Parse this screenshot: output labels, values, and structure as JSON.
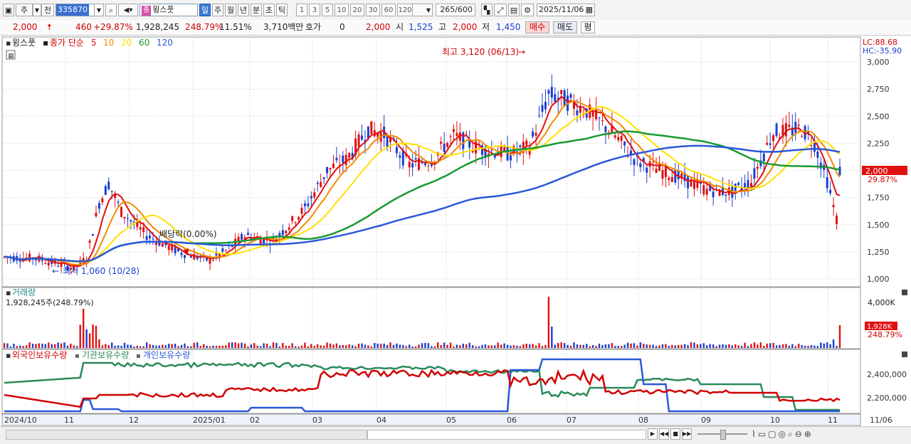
{
  "toolbar": {
    "market_label": "주",
    "prev_label": "전",
    "code": "335870",
    "name_tag": "종",
    "name": "윙스풋",
    "periods": [
      "일",
      "주",
      "월",
      "년",
      "분",
      "초",
      "틱"
    ],
    "selected_period": "일",
    "intervals": [
      "1",
      "3",
      "5",
      "10",
      "20",
      "30",
      "60",
      "120"
    ],
    "count": "265",
    "count_total": "/600",
    "date": "2025/11/06"
  },
  "quote": {
    "price": "2,000",
    "change": "460",
    "change_pct": "+29.87%",
    "volume": "1,928,245",
    "volume_pct": "248.79%",
    "turnover_pct": "11.51%",
    "amount": "3,710백만",
    "hoga_label": "호가",
    "hoga_value": "0",
    "hoga_price": "2,000",
    "open_label": "시",
    "open": "1,525",
    "high_label": "고",
    "high": "2,000",
    "low_label": "저",
    "low": "1,450",
    "buy": "매수",
    "sell": "매도",
    "eval": "평"
  },
  "price_panel": {
    "name": "윙스풋",
    "legend_title": "종가 단순",
    "ma": [
      {
        "period": "5",
        "color": "#e01010"
      },
      {
        "period": "10",
        "color": "#f08c00"
      },
      {
        "period": "20",
        "color": "#ffe000"
      },
      {
        "period": "60",
        "color": "#1a9a30"
      },
      {
        "period": "120",
        "color": "#2a58d8"
      }
    ],
    "lc": "LC:88.68",
    "hc": "HC:-35.90",
    "high_annotation": "최고 3,120 (06/13)",
    "low_annotation": "최저 1,060 (10/28)",
    "dividend_annotation": "배당락(0.00%)",
    "y_ticks": [
      "3,000",
      "2,750",
      "2,500",
      "2,250",
      "2,000",
      "1,750",
      "1,500",
      "1,250",
      "1,000"
    ],
    "current_price_tag": "2,000",
    "current_pct_tag": "29.87%"
  },
  "volume_panel": {
    "title": "거래량",
    "value": "1,928,245주(248.79%)",
    "y_tick": "4,000K",
    "current_tag": "1,928K",
    "current_pct": "248.79%"
  },
  "holding_panel": {
    "series": [
      {
        "name": "외국인보유수량",
        "color": "#d10000"
      },
      {
        "name": "기관보유수량",
        "color": "#2a8a5a"
      },
      {
        "name": "개인보유수량",
        "color": "#2a58d8"
      }
    ],
    "y_ticks": [
      "2,400,000",
      "2,200,000"
    ]
  },
  "x_axis": [
    "2024/10",
    "11",
    "12",
    "2025/01",
    "02",
    "03",
    "04",
    "05",
    "06",
    "07",
    "08",
    "09",
    "10",
    "11",
    "11/06"
  ]
}
